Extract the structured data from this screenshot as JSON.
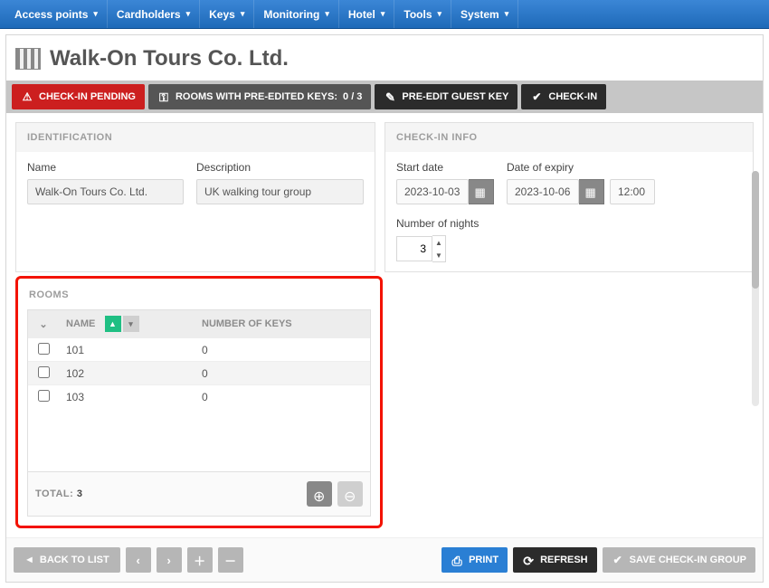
{
  "nav": {
    "items": [
      "Access points",
      "Cardholders",
      "Keys",
      "Monitoring",
      "Hotel",
      "Tools",
      "System"
    ]
  },
  "page_title": "Walk-On Tours Co. Ltd.",
  "action_bar": {
    "checkin_pending": "CHECK-IN PENDING",
    "rooms_keys_label": "ROOMS WITH PRE-EDITED KEYS:",
    "rooms_keys_value": "0 / 3",
    "pre_edit": "PRE-EDIT GUEST KEY",
    "checkin": "CHECK-IN"
  },
  "identification": {
    "panel_title": "IDENTIFICATION",
    "name_label": "Name",
    "name_value": "Walk-On Tours Co. Ltd.",
    "desc_label": "Description",
    "desc_value": "UK walking tour group"
  },
  "checkin_info": {
    "panel_title": "CHECK-IN INFO",
    "start_label": "Start date",
    "start_value": "2023-10-03",
    "expiry_label": "Date of expiry",
    "expiry_value": "2023-10-06",
    "expiry_time": "12:00",
    "nights_label": "Number of nights",
    "nights_value": "3"
  },
  "rooms": {
    "panel_title": "ROOMS",
    "col_name": "NAME",
    "col_keys": "NUMBER OF KEYS",
    "rows": [
      {
        "name": "101",
        "keys": "0"
      },
      {
        "name": "102",
        "keys": "0"
      },
      {
        "name": "103",
        "keys": "0"
      }
    ],
    "total_label": "TOTAL:",
    "total_value": "3"
  },
  "footer": {
    "back": "BACK TO LIST",
    "print": "PRINT",
    "refresh": "REFRESH",
    "save": "SAVE CHECK-IN GROUP"
  }
}
